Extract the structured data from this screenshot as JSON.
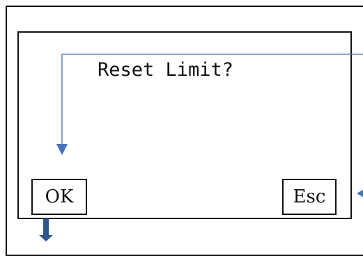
{
  "dialog": {
    "prompt": "Reset Limit?",
    "ok_label": "OK",
    "esc_label": "Esc"
  },
  "colors": {
    "frame": "#111111",
    "callout_arrow": "#4472c4",
    "down_arrow": "#2f5597",
    "background": "#ffffff"
  }
}
